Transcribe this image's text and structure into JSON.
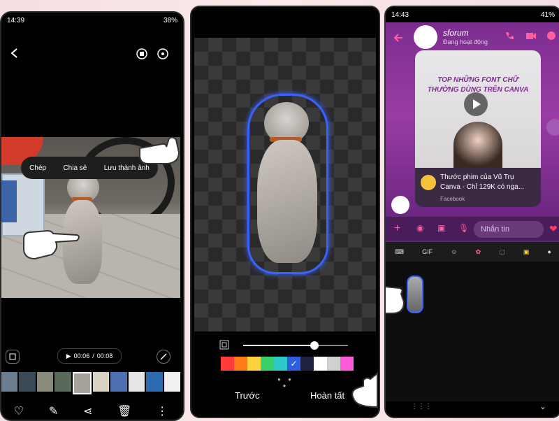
{
  "phone1": {
    "status": {
      "time": "14:39",
      "right": "38%"
    },
    "context_menu": {
      "copy": "Chép",
      "share": "Chia sẻ",
      "save_image": "Lưu thành ảnh"
    },
    "video": {
      "time": "00:06",
      "separator": "/",
      "duration": "00:08"
    },
    "icons": [
      "back-icon",
      "rotate-icon",
      "settings-icon",
      "screenshot-icon",
      "mute-icon",
      "heart-icon",
      "edit-icon",
      "share-icon",
      "delete-icon",
      "more-icon"
    ]
  },
  "phone2": {
    "footer": {
      "prev": "Trước",
      "done": "Hoàn tất"
    },
    "slider_fraction": 0.68,
    "palette_colors": [
      "#ff3b3b",
      "#ff7a1a",
      "#ffd23b",
      "#38d16b",
      "#2ec7c9",
      "#2f5fe0",
      "#1f2240",
      "#ffffff",
      "#d0d0d0",
      "#ff5ad7"
    ]
  },
  "phone3": {
    "status": {
      "time": "14:43",
      "right": "41%"
    },
    "chat": {
      "name": "sforum",
      "status": "Đang hoạt động"
    },
    "card": {
      "thumb_title_1": "TOP NHỮNG FONT CHỮ",
      "thumb_title_2": "THƯỜNG DÙNG TRÊN CANVA",
      "line1": "Thước phim của Vũ Trụ",
      "line2": "Canva - Chỉ 129K có nga...",
      "source": "Facebook"
    },
    "input_placeholder": "Nhắn tin",
    "tray_labels": [
      "GIF"
    ]
  }
}
